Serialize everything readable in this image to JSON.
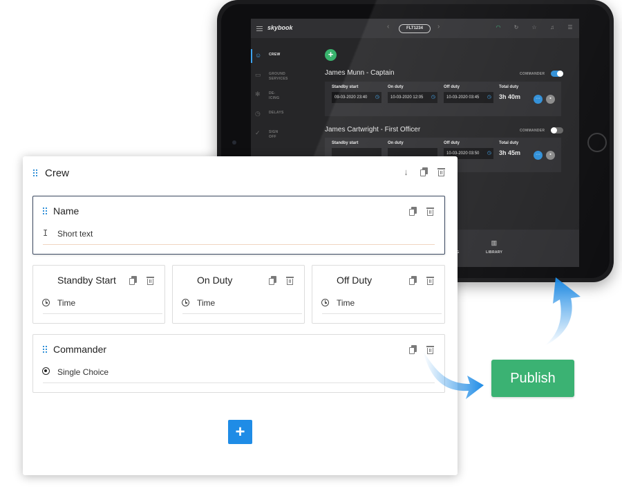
{
  "tablet": {
    "brand": "skybook",
    "flight": "FLT1234",
    "sidebar": [
      {
        "label": "CREW",
        "icon": "person-icon"
      },
      {
        "label": "GROUND SERVICES",
        "icon": "ground-services-icon"
      },
      {
        "label": "DE-ICING",
        "icon": "snowflake-icon"
      },
      {
        "label": "DELAYS",
        "icon": "stopwatch-icon"
      },
      {
        "label": "SIGN OFF",
        "icon": "check-circle-icon"
      }
    ],
    "commander_label": "COMMANDER",
    "crew": [
      {
        "name": "James Munn - Captain",
        "commander": true,
        "standby_label": "Standby start",
        "standby_value": "09-03-2020 23:40",
        "onduty_label": "On duty",
        "onduty_value": "10-03-2020 12:05",
        "offduty_label": "Off duty",
        "offduty_value": "10-03-2020 03:45",
        "total_label": "Total duty",
        "total_value": "3h 40m"
      },
      {
        "name": "James Cartwright  - First Officer",
        "commander": false,
        "standby_label": "Standby start",
        "standby_value": "",
        "onduty_label": "On duty",
        "onduty_value": "",
        "offduty_label": "Off duty",
        "offduty_value": "10-03-2020 03:50",
        "total_label": "Total duty",
        "total_value": "3h 45m"
      }
    ],
    "bottom_nav": [
      "LOG",
      "LIBRARY"
    ]
  },
  "builder": {
    "title": "Crew",
    "fields": {
      "name": {
        "title": "Name",
        "type": "Short text"
      },
      "standby": {
        "title": "Standby Start",
        "type": "Time"
      },
      "onduty": {
        "title": "On Duty",
        "type": "Time"
      },
      "offduty": {
        "title": "Off Duty",
        "type": "Time"
      },
      "commander": {
        "title": "Commander",
        "type": "Single Choice"
      }
    },
    "add_label": "+"
  },
  "publish_label": "Publish",
  "colors": {
    "accent_blue": "#1f8ce6",
    "publish_green": "#3bb273",
    "add_green": "#39b36d"
  }
}
